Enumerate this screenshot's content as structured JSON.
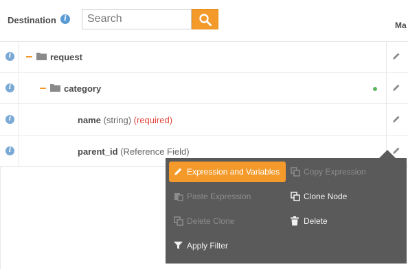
{
  "header": {
    "destination_label": "Destination",
    "info_glyph": "i",
    "search_placeholder": "Search",
    "search_value": "",
    "right_column_label": "Ma"
  },
  "tree": [
    {
      "name": "request",
      "type": "",
      "required": "",
      "kind": "folder",
      "depth": 0
    },
    {
      "name": "category",
      "type": "",
      "required": "",
      "kind": "folder",
      "depth": 1,
      "status": "green-dot"
    },
    {
      "name": "name",
      "type": "(string)",
      "required": "(required)",
      "kind": "field",
      "depth": 2
    },
    {
      "name": "parent_id",
      "type": "(Reference Field)",
      "required": "",
      "kind": "field",
      "depth": 2
    }
  ],
  "context_menu": {
    "items": [
      {
        "label": "Expression and Variables",
        "icon": "pencil-icon",
        "state": "active"
      },
      {
        "label": "Copy Expression",
        "icon": "copy-icon",
        "state": "disabled"
      },
      {
        "label": "Paste Expression",
        "icon": "paste-icon",
        "state": "disabled"
      },
      {
        "label": "Clone Node",
        "icon": "clone-icon",
        "state": "enabled"
      },
      {
        "label": "Delete Clone",
        "icon": "clone-icon",
        "state": "disabled"
      },
      {
        "label": "Delete",
        "icon": "trash-icon",
        "state": "enabled"
      },
      {
        "label": "Apply Filter",
        "icon": "filter-icon",
        "state": "enabled"
      }
    ]
  },
  "colors": {
    "accent": "#f39a2b",
    "info": "#7aa9d6",
    "required": "#e0453a",
    "menu_bg": "#5a5a5a",
    "status_ok": "#5cb85c"
  }
}
